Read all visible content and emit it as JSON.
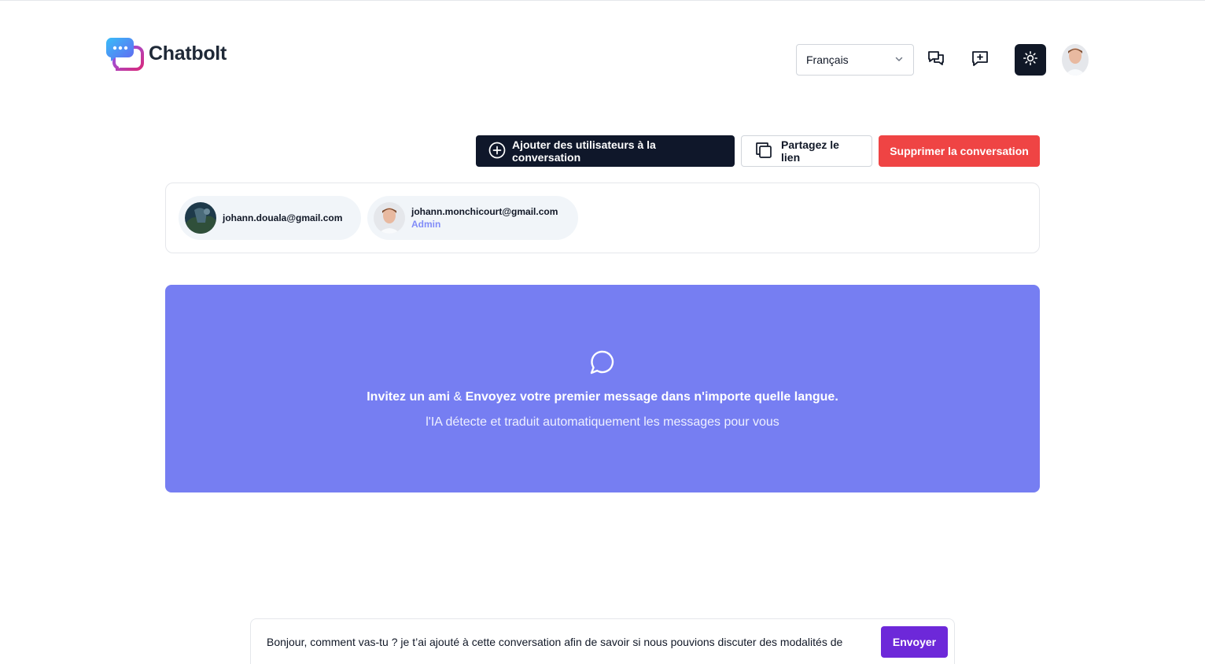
{
  "header": {
    "logo_text": "Chatbolt",
    "language": {
      "selected": "Français"
    },
    "icons": {
      "chats": "chats-icon",
      "new_chat": "message-plus-icon",
      "theme": "sun-icon"
    }
  },
  "actions": {
    "add_users_label": "Ajouter des utilisateurs à la conversation",
    "share_label": "Partagez le lien",
    "delete_label": "Supprimer la conversation"
  },
  "participants": [
    {
      "email": "johann.douala@gmail.com",
      "role": ""
    },
    {
      "email": "johann.monchicourt@gmail.com",
      "role": "Admin"
    }
  ],
  "empty_state": {
    "title_part1": "Invitez un ami",
    "title_amp": " & ",
    "title_part2": "Envoyez votre premier message dans n'importe quelle langue.",
    "subtitle": "l'IA détecte et traduit automatiquement les messages pour vous"
  },
  "composer": {
    "value": "Bonjour, comment vas-tu ? je t’ai ajouté à cette conversation afin de savoir si nous pouvions discuter des modalités de",
    "send_label": "Envoyer"
  },
  "colors": {
    "primary_dark": "#0f172a",
    "danger": "#ef4444",
    "accent_panel": "#767ef2",
    "send": "#6d28d9"
  }
}
